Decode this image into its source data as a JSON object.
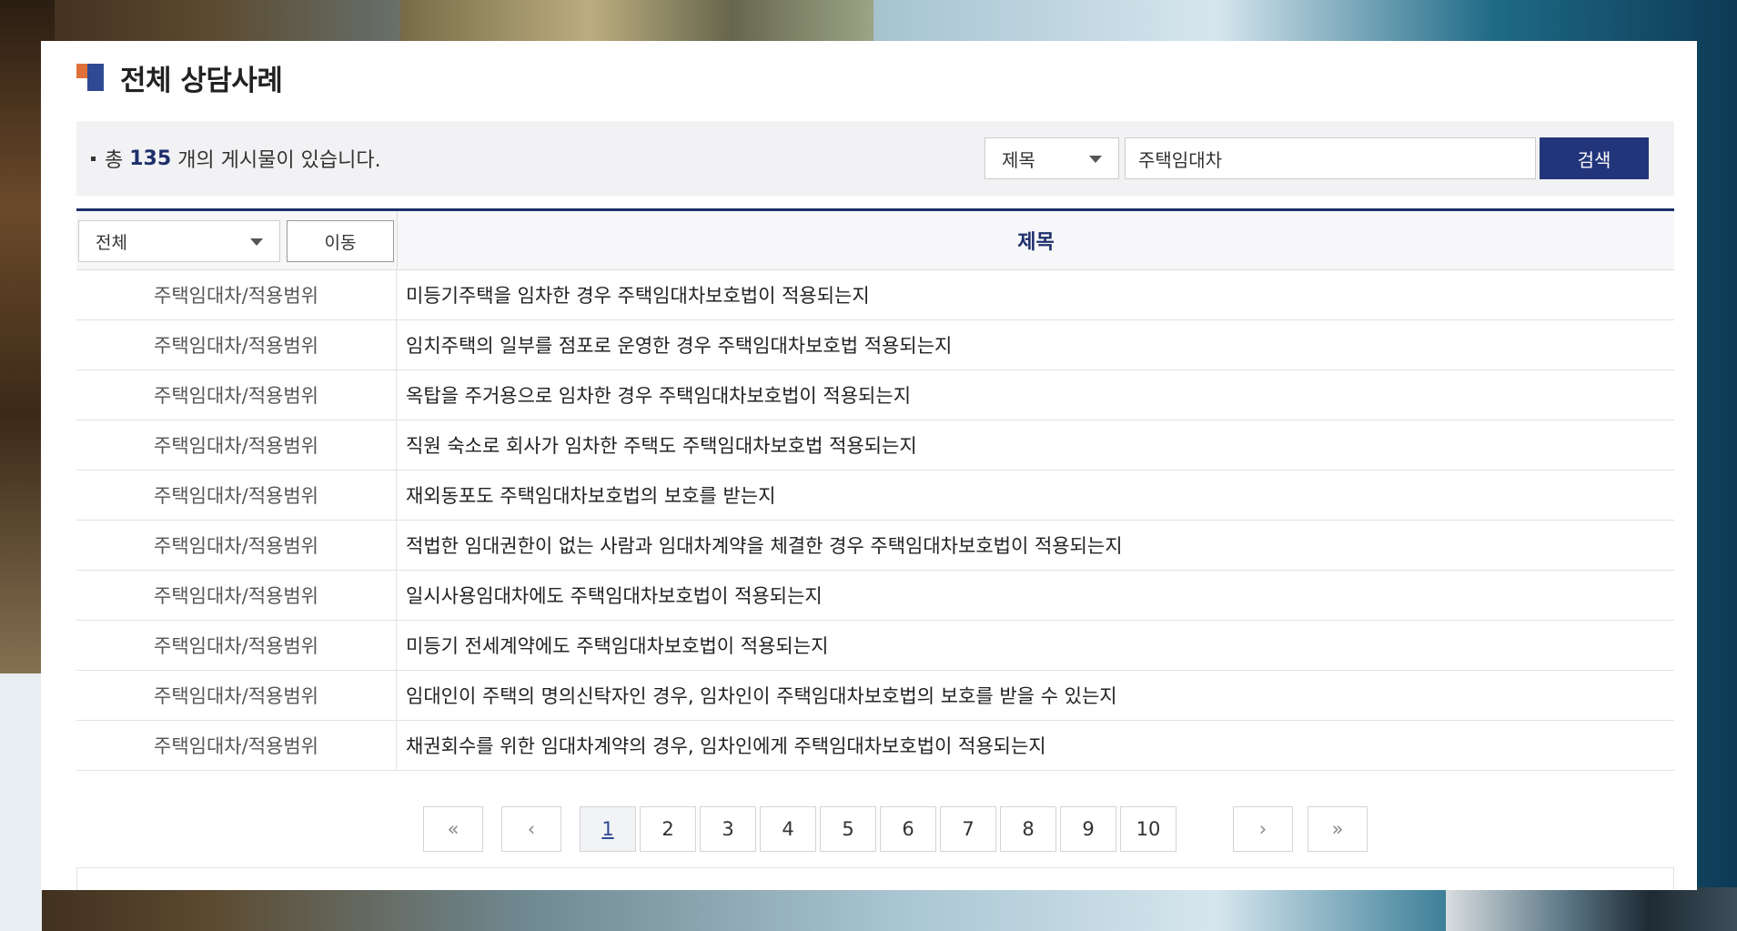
{
  "page": {
    "title": "전체 상담사례"
  },
  "summary": {
    "prefix": "총",
    "count": "135",
    "suffix": "개의 게시물이 있습니다."
  },
  "search": {
    "field": "제목",
    "query": "주택임대차",
    "button": "검색"
  },
  "table": {
    "category_filter": "전체",
    "move_button": "이동",
    "column_title": "제목",
    "rows": [
      {
        "category": "주택임대차/적용범위",
        "title": "미등기주택을 임차한 경우 주택임대차보호법이 적용되는지"
      },
      {
        "category": "주택임대차/적용범위",
        "title": "임치주택의 일부를 점포로 운영한 경우 주택임대차보호법 적용되는지"
      },
      {
        "category": "주택임대차/적용범위",
        "title": "옥탑을 주거용으로 임차한 경우 주택임대차보호법이 적용되는지"
      },
      {
        "category": "주택임대차/적용범위",
        "title": "직원 숙소로 회사가 임차한 주택도 주택임대차보호법 적용되는지"
      },
      {
        "category": "주택임대차/적용범위",
        "title": "재외동포도 주택임대차보호법의 보호를 받는지"
      },
      {
        "category": "주택임대차/적용범위",
        "title": "적법한 임대권한이 없는 사람과 임대차계약을 체결한 경우 주택임대차보호법이 적용되는지"
      },
      {
        "category": "주택임대차/적용범위",
        "title": "일시사용임대차에도 주택임대차보호법이 적용되는지"
      },
      {
        "category": "주택임대차/적용범위",
        "title": "미등기 전세계약에도 주택임대차보호법이 적용되는지"
      },
      {
        "category": "주택임대차/적용범위",
        "title": "임대인이 주택의 명의신탁자인 경우, 임차인이 주택임대차보호법의 보호를 받을 수 있는지"
      },
      {
        "category": "주택임대차/적용범위",
        "title": "채권회수를 위한 임대차계약의 경우, 임차인에게 주택임대차보호법이 적용되는지"
      }
    ]
  },
  "pagination": {
    "first": "«",
    "prev": "‹",
    "pages": [
      "1",
      "2",
      "3",
      "4",
      "5",
      "6",
      "7",
      "8",
      "9",
      "10"
    ],
    "current": "1",
    "next": "›",
    "last": "»"
  },
  "colors": {
    "accent": "#23357a",
    "logo_orange": "#e0703a",
    "logo_blue": "#2f4a93"
  }
}
